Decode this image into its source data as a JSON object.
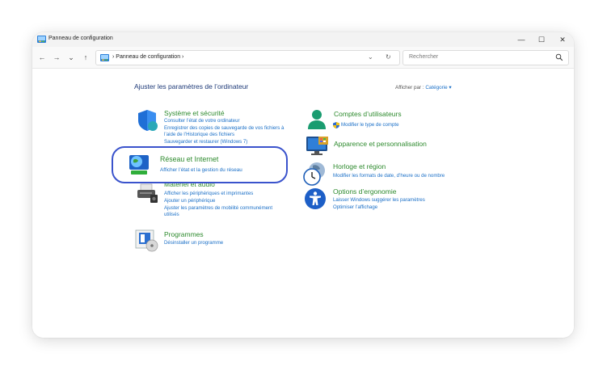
{
  "window": {
    "title": "Panneau de configuration",
    "controls": {
      "minimize": "—",
      "maximize": "☐",
      "close": "✕"
    }
  },
  "toolbar": {
    "back": "←",
    "forward": "→",
    "recent": "⌄",
    "up": "↑",
    "breadcrumb": [
      "›",
      "Panneau de configuration",
      "›"
    ],
    "dropdown": "⌄",
    "refresh": "↻",
    "search_placeholder": "Rechercher"
  },
  "main": {
    "heading": "Ajuster les paramètres de l’ordinateur",
    "view_by_label": "Afficher par :",
    "view_by_value": "Catégorie ▾"
  },
  "categories": {
    "system": {
      "title": "Système et sécurité",
      "links": [
        "Consulter l’état de votre ordinateur",
        "Enregistrer des copies de sauvegarde de vos fichiers à",
        "l’aide de l’Historique des fichiers",
        "Sauvegarder et restaurer (Windows 7)"
      ]
    },
    "network": {
      "title": "Réseau et Internet",
      "links": [
        "Afficher l’état et la gestion du réseau"
      ]
    },
    "hardware": {
      "title": "Matériel et audio",
      "links": [
        "Afficher les périphériques et imprimantes",
        "Ajouter un périphérique",
        "Ajuster les paramètres de mobilité communément",
        "utilisés"
      ]
    },
    "programs": {
      "title": "Programmes",
      "links": [
        "Désinstaller un programme"
      ]
    },
    "users": {
      "title": "Comptes d’utilisateurs",
      "links": [
        "Modifier le type de compte"
      ]
    },
    "appearance": {
      "title": "Apparence et personnalisation",
      "links": []
    },
    "clock": {
      "title": "Horloge et région",
      "links": [
        "Modifier les formats de date, d’heure ou de nombre"
      ]
    },
    "ease": {
      "title": "Options d’ergonomie",
      "links": [
        "Laisser Windows suggérer les paramètres",
        "Optimiser l’affichage"
      ]
    }
  },
  "colors": {
    "link": "#1a6fc7",
    "category_title": "#2d8a2d",
    "heading": "#1e3a78",
    "highlight_border": "#3a53cc"
  }
}
